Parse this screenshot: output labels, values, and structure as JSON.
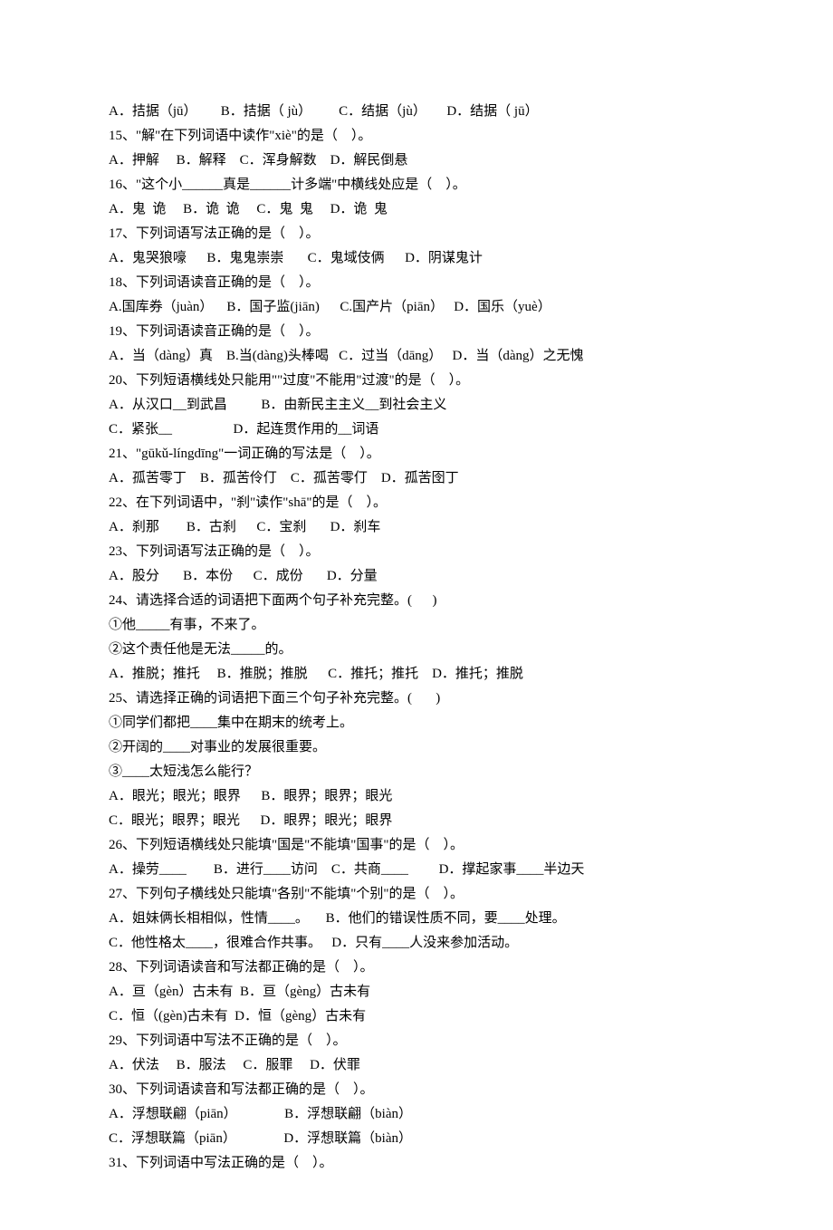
{
  "lines": [
    "A．拮据（jū）       B．拮据（ jù）        C．结据（jù）      D．结据（ jū）",
    "15、\"解\"在下列词语中读作\"xiè\"的是（    ）。",
    "A．押解     B．解释    C．浑身解数    D．解民倒悬",
    "16、\"这个小______真是______计多端\"中横线处应是（    ）。",
    "A．鬼  诡     B．诡  诡     C．鬼  鬼     D．诡  鬼",
    "17、下列词语写法正确的是（    ）。",
    "A．鬼哭狼嚎      B．鬼鬼崇崇       C．鬼域伎俩      D．阴谋鬼计",
    "18、下列词语读音正确的是（    ）。",
    "A.国库券（juàn）    B．国子监(jiān)      C.国产片（piān）   D．国乐（yuè）",
    "19、下列词语读音正确的是（    ）。",
    "A．当（dàng）真    B.当(dàng)头棒喝   C．过当（dāng）   D．当（dàng）之无愧",
    "20、下列短语横线处只能用\"\"过度\"不能用\"过渡\"的是（    ）。",
    "A．从汉口__到武昌          B．由新民主主义__到社会主义",
    "C．紧张__                  D．起连贯作用的__词语",
    "21、\"gūkǔ-língdīng\"一词正确的写法是（    ）。",
    "A．孤苦零丁    B．孤苦伶仃    C．孤苦零仃    D．孤苦囹丁",
    "22、在下列词语中，\"刹\"读作\"shā\"的是（    ）。",
    "A．刹那        B．古刹      C．宝刹       D．刹车",
    "23、下列词语写法正确的是（    ）。",
    "A．股分       B．本份      C．成份       D．分量",
    "24、请选择合适的词语把下面两个句子补充完整。(      )",
    "①他_____有事，不来了。",
    "②这个责任他是无法_____的。",
    "A．推脱；推托     B．推脱；推脱      C．推托；推托    D．推托；推脱",
    "25、请选择正确的词语把下面三个句子补充完整。(       )",
    "①同学们都把____集中在期末的统考上。",
    "②开阔的____对事业的发展很重要。",
    "③____太短浅怎么能行？",
    "A．眼光；眼光；眼界      B．眼界；眼界；眼光",
    "C．眼光；眼界；眼光      D．眼界；眼光；眼界",
    "26、下列短语横线处只能填\"国是\"不能填\"国事\"的是（    ）。",
    "A．操劳____        B．进行____访问    C．共商____         D．撑起家事____半边天",
    "27、下列句子横线处只能填\"各别\"不能填\"个别\"的是（    ）。",
    "A．姐妹俩长相相似，性情____。     B．他们的错误性质不同，要____处理。",
    "C．他性格太____，很难合作共事。   D．只有____人没来参加活动。",
    "28、下列词语读音和写法都正确的是（    ）。",
    "A．亘（gèn）古未有  B．亘（gèng）古未有",
    "C．恒（(gèn)古未有  D．恒（gèng）古未有",
    "29、下列词语中写法不正确的是（    ）。",
    "A．伏法     B．服法     C．服罪     D．伏罪",
    "30、下列词语读音和写法都正确的是（    ）。",
    "A．浮想联翩（piān）              B．浮想联翩（biàn）",
    "C．浮想联篇（piān）              D．浮想联篇（biàn）",
    "31、下列词语中写法正确的是（    ）。"
  ]
}
